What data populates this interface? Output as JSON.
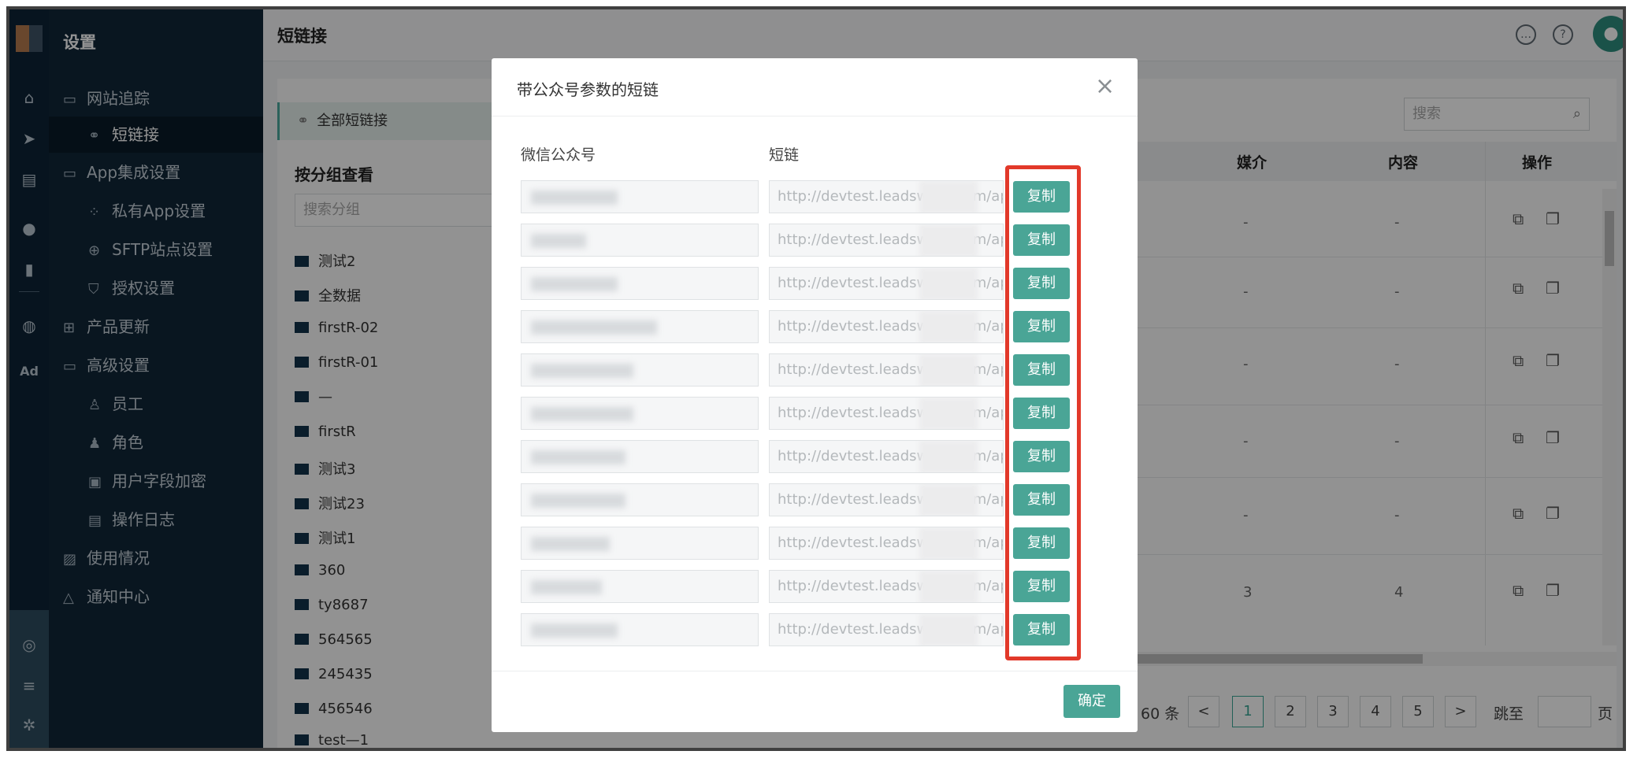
{
  "sidebar": {
    "title": "设置",
    "rail_icons": [
      "home-icon",
      "send-icon",
      "layout-icon",
      "user-icon",
      "bar-chart-icon",
      "wechat-icon",
      "ad-icon"
    ],
    "rail_ad_label": "Ad",
    "items": [
      {
        "label": "网站追踪"
      },
      {
        "label": "短链接"
      },
      {
        "label": "App集成设置"
      },
      {
        "label": "私有App设置"
      },
      {
        "label": "SFTP站点设置"
      },
      {
        "label": "授权设置"
      },
      {
        "label": "产品更新"
      },
      {
        "label": "高级设置"
      },
      {
        "label": "员工"
      },
      {
        "label": "角色"
      },
      {
        "label": "用户字段加密"
      },
      {
        "label": "操作日志"
      },
      {
        "label": "使用情况"
      },
      {
        "label": "通知中心"
      }
    ]
  },
  "header": {
    "title": "短链接"
  },
  "groups": {
    "tab": "全部短链接",
    "heading": "按分组查看",
    "search_placeholder": "搜索分组",
    "items": [
      "测试2",
      "全数据",
      "firstR-02",
      "firstR-01",
      "—",
      "firstR",
      "测试3",
      "测试23",
      "测试1",
      "360",
      "ty8687",
      "564565",
      "245435",
      "456546",
      "test—1"
    ]
  },
  "table": {
    "search_placeholder": "搜索",
    "columns": [
      "媒介",
      "内容",
      "操作"
    ],
    "rows": [
      {
        "media": "-",
        "content": "-"
      },
      {
        "media": "-",
        "content": "-"
      },
      {
        "media": "-",
        "content": "-"
      },
      {
        "media": "-",
        "content": "-"
      },
      {
        "media": "-",
        "content": "-"
      },
      {
        "media": "3",
        "content": "4"
      }
    ],
    "pagination": {
      "total_text": "60 条",
      "prev": "<",
      "pages": [
        "1",
        "2",
        "3",
        "4",
        "5"
      ],
      "current": "1",
      "next": ">",
      "jump_label": "跳至",
      "page_suffix": "页"
    }
  },
  "modal": {
    "title": "带公众号参数的短链",
    "close": "×",
    "col_account": "微信公众号",
    "col_link": "短链",
    "copy_label": "复制",
    "ok_label": "确定",
    "rows": [
      {
        "link": "http://devtest.leadswarp.com/api"
      },
      {
        "link": "http://devtest.leadswarp.com/api"
      },
      {
        "link": "http://devtest.leadswarp.com/api"
      },
      {
        "link": "http://devtest.leadswarp.com/api"
      },
      {
        "link": "http://devtest.leadswarp.com/api"
      },
      {
        "link": "http://devtest.leadswarp.com/api"
      },
      {
        "link": "http://devtest.leadswarp.com/api"
      },
      {
        "link": "http://devtest.leadswarp.com/api"
      },
      {
        "link": "http://devtest.leadswarp.com/api"
      },
      {
        "link": "http://devtest.leadswarp.com/api"
      },
      {
        "link": "http://devtest.leadswarp.com/api"
      }
    ]
  },
  "colors": {
    "accent": "#4aa596",
    "sidebar_bg": "#102638",
    "highlight": "#e2392a"
  }
}
